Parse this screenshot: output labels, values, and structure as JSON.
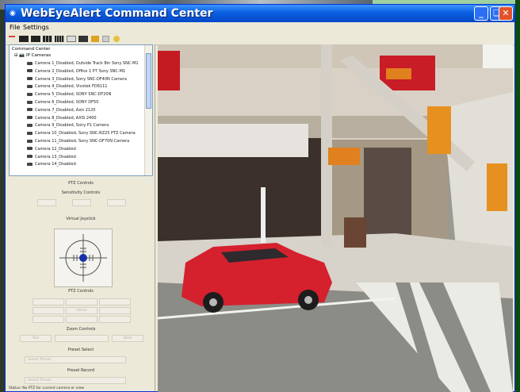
{
  "window": {
    "title": "WebEyeAlert Command Center"
  },
  "menu": [
    {
      "label": "File"
    },
    {
      "label": "Settings"
    }
  ],
  "tree": {
    "root": "Command Center",
    "group": "IP Cameras",
    "cameras": [
      "Camera 1_Disabled, Outside Track Bin Sony SNC-M1",
      "Camera 2_Disabled, Office 1 P7 Sony SNC-M1",
      "Camera 3_Disabled, Sony SNC-DF40N Camera",
      "Camera 4_Disabled, Vivotek FD6111",
      "Camera 5_Disabled, SONY SNC-DF20N",
      "Camera 6_Disabled, SONY DF50",
      "Camera 7_Disabled, Axis 2120",
      "Camera 8_Disabled, AXIS 2400",
      "Camera 9_Disabled, Sony P1 Camera",
      "Camera 10_Disabled, Sony SNC-RZ25 PTZ Camera",
      "Camera 11_Disabled, Sony SNC-DF70N Camera",
      "Camera 12_Disabled",
      "Camera 13_Disabled",
      "Camera 14_Disabled"
    ]
  },
  "controls": {
    "ptz_title": "PTZ Controls",
    "sensitivity_title": "Sensitivity Controls",
    "joystick_title": "Virtual Joystick",
    "ptz_title_2": "PTZ Controls",
    "home_label": "Home",
    "zoom_title": "Zoom Controls",
    "zoom_in": "Tele",
    "zoom_out": "Wide",
    "preset_select_title": "Preset Select",
    "preset_select_value": "Select Preset",
    "preset_record_title": "Preset Record",
    "preset_record_value": "Select Preset"
  },
  "status_text": "Status:  No PTZ for current camera or view",
  "colors": {
    "titlebar": "#0a5fe0",
    "window_bg": "#ece9d8",
    "car": "#d5202e",
    "joystick_dot": "#1630a8"
  }
}
